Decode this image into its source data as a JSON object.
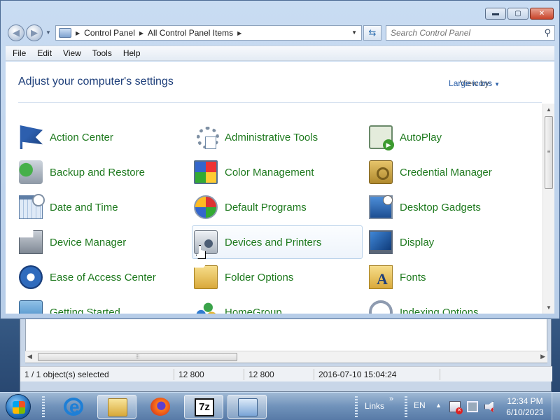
{
  "window": {
    "controls": {
      "minimize": "▬",
      "maximize": "▢",
      "close": "✕"
    }
  },
  "address_bar": {
    "crumbs": [
      "Control Panel",
      "All Control Panel Items"
    ],
    "search_placeholder": "Search Control Panel"
  },
  "menu": [
    "File",
    "Edit",
    "View",
    "Tools",
    "Help"
  ],
  "content": {
    "heading": "Adjust your computer's settings",
    "view_by_label": "View by:",
    "view_by_value": "Large icons",
    "items": [
      {
        "label": "Action Center",
        "icon": "action-center-flag-icon"
      },
      {
        "label": "Administrative Tools",
        "icon": "administrative-tools-icon"
      },
      {
        "label": "AutoPlay",
        "icon": "autoplay-icon"
      },
      {
        "label": "Backup and Restore",
        "icon": "backup-restore-icon"
      },
      {
        "label": "Color Management",
        "icon": "color-management-icon"
      },
      {
        "label": "Credential Manager",
        "icon": "credential-manager-icon"
      },
      {
        "label": "Date and Time",
        "icon": "date-time-icon"
      },
      {
        "label": "Default Programs",
        "icon": "default-programs-icon"
      },
      {
        "label": "Desktop Gadgets",
        "icon": "desktop-gadgets-icon"
      },
      {
        "label": "Device Manager",
        "icon": "device-manager-icon"
      },
      {
        "label": "Devices and Printers",
        "icon": "devices-printers-icon",
        "hovered": true
      },
      {
        "label": "Display",
        "icon": "display-icon"
      },
      {
        "label": "Ease of Access Center",
        "icon": "ease-of-access-icon"
      },
      {
        "label": "Folder Options",
        "icon": "folder-options-icon"
      },
      {
        "label": "Fonts",
        "icon": "fonts-icon"
      },
      {
        "label": "Getting Started",
        "icon": "getting-started-icon"
      },
      {
        "label": "HomeGroup",
        "icon": "homegroup-icon"
      },
      {
        "label": "Indexing Options",
        "icon": "indexing-options-icon"
      }
    ]
  },
  "background_window": {
    "status": [
      "1 / 1 object(s) selected",
      "12 800",
      "12 800",
      "2016-07-10 15:04:24"
    ]
  },
  "taskbar": {
    "apps": [
      "Internet Explorer",
      "Windows Explorer",
      "Firefox",
      "7-Zip",
      "Control Panel"
    ],
    "links_label": "Links",
    "language": "EN",
    "time": "12:34 PM",
    "date": "6/10/2023"
  },
  "colors": {
    "link_green": "#1f7a1f",
    "heading_blue": "#1e3f7a",
    "accent_blue": "#2a5fa8"
  }
}
